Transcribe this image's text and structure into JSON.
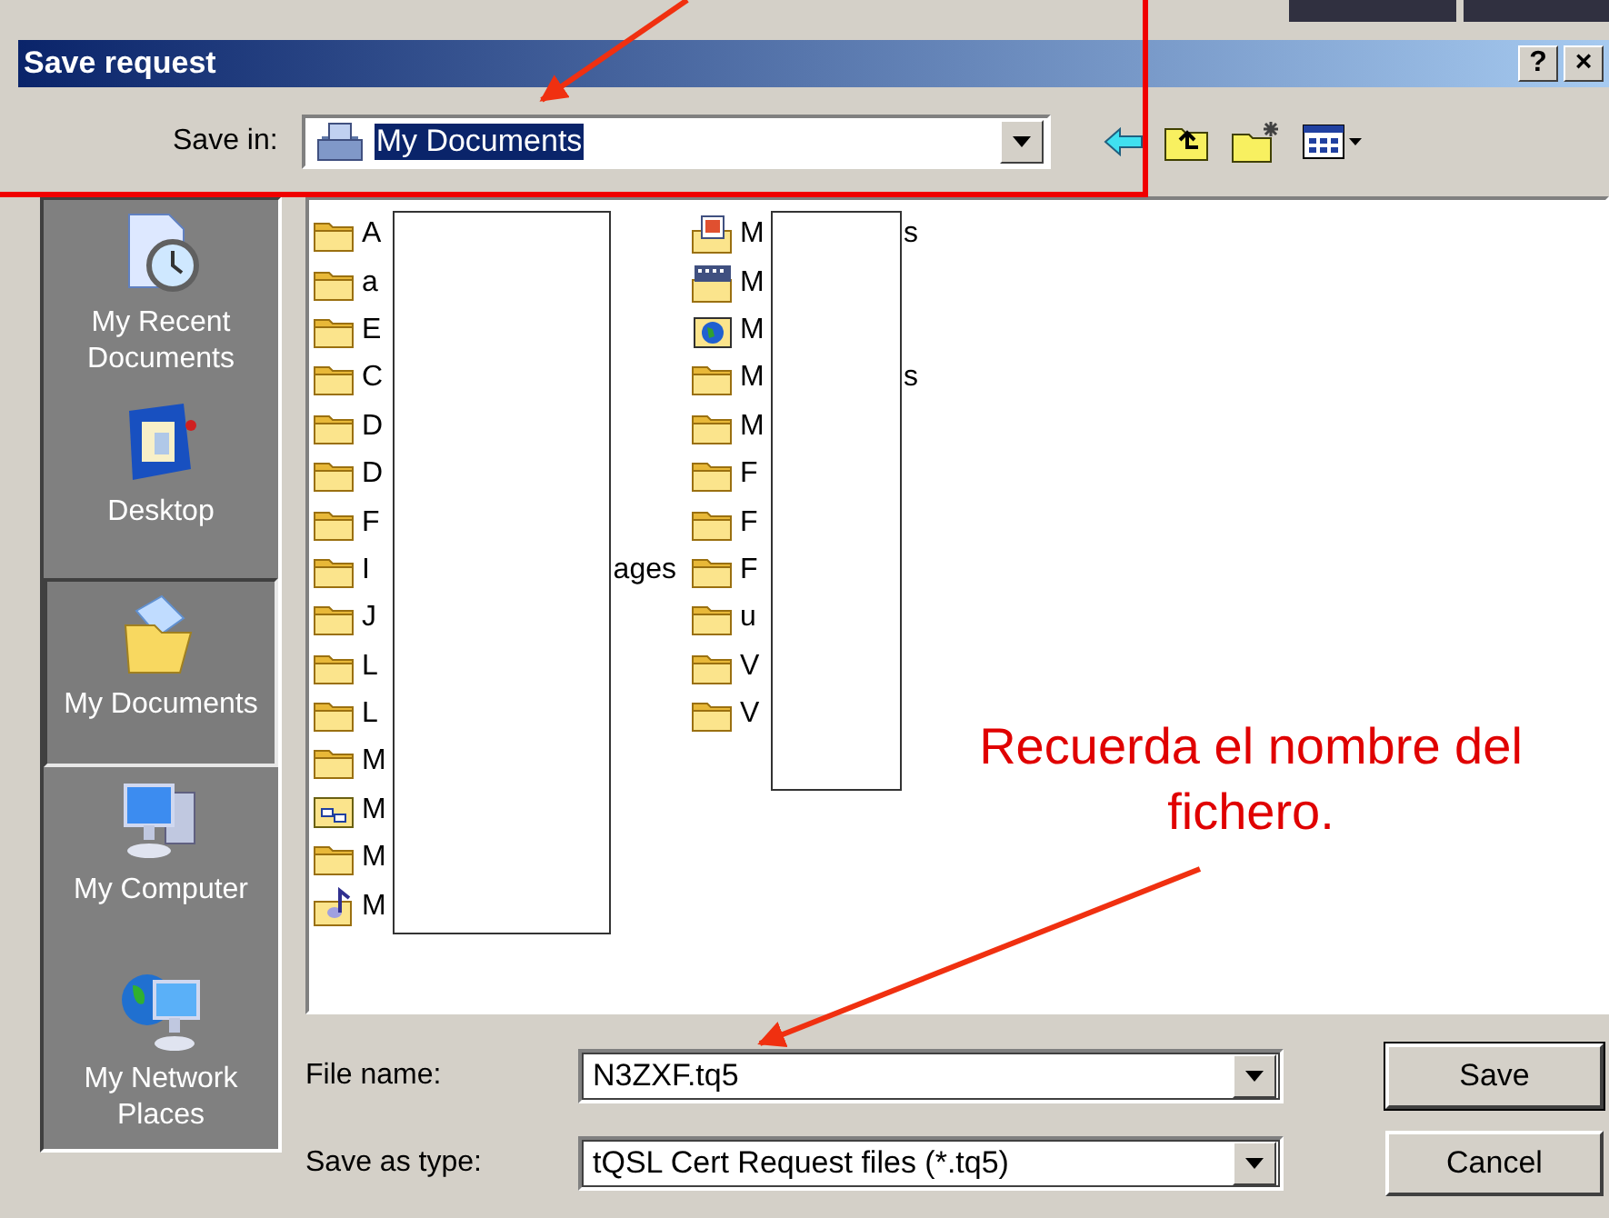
{
  "window": {
    "title": "Save request",
    "help_button": "?",
    "close_button": "×"
  },
  "save_in": {
    "label": "Save in:",
    "value": "My Documents"
  },
  "places": [
    {
      "label": "My Recent Documents",
      "kind": "recent",
      "selected": false
    },
    {
      "label": "Desktop",
      "kind": "desktop",
      "selected": false
    },
    {
      "label": "My Documents",
      "kind": "documents",
      "selected": true
    },
    {
      "label": "My Computer",
      "kind": "computer",
      "selected": false
    },
    {
      "label": "My Network Places",
      "kind": "network",
      "selected": false
    }
  ],
  "files": {
    "columns": [
      [
        {
          "start": "A",
          "kind": "folder"
        },
        {
          "start": "a",
          "kind": "folder"
        },
        {
          "start": "E",
          "kind": "folder"
        },
        {
          "start": "C",
          "kind": "folder"
        },
        {
          "start": "D",
          "kind": "folder"
        },
        {
          "start": "D",
          "kind": "folder"
        },
        {
          "start": "F",
          "kind": "folder"
        },
        {
          "start": "I",
          "end": "ages",
          "kind": "folder"
        },
        {
          "start": "J",
          "kind": "folder"
        },
        {
          "start": "L",
          "kind": "folder"
        },
        {
          "start": "L",
          "kind": "folder"
        },
        {
          "start": "M",
          "kind": "folder"
        },
        {
          "start": "M",
          "kind": "shared"
        },
        {
          "start": "M",
          "kind": "folder"
        },
        {
          "start": "M",
          "kind": "music"
        }
      ],
      [
        {
          "start": "M",
          "end": "s",
          "kind": "pictures"
        },
        {
          "start": "M",
          "kind": "video"
        },
        {
          "start": "M",
          "kind": "web"
        },
        {
          "start": "M",
          "end": "s",
          "kind": "folder"
        },
        {
          "start": "M",
          "kind": "folder"
        },
        {
          "start": "F",
          "kind": "folder"
        },
        {
          "start": "F",
          "kind": "folder"
        },
        {
          "start": "F",
          "kind": "folder"
        },
        {
          "start": "u",
          "kind": "folder"
        },
        {
          "start": "V",
          "kind": "folder"
        },
        {
          "start": "V",
          "kind": "folder"
        }
      ]
    ]
  },
  "file_name": {
    "label": "File name:",
    "value": "N3ZXF.tq5"
  },
  "save_as_type": {
    "label": "Save as type:",
    "value": "tQSL Cert Request files (*.tq5)"
  },
  "buttons": [
    {
      "label": "Save",
      "default": true
    },
    {
      "label": "Cancel",
      "default": false
    }
  ],
  "annotation": {
    "text": "Recuerda el nombre del fichero."
  }
}
